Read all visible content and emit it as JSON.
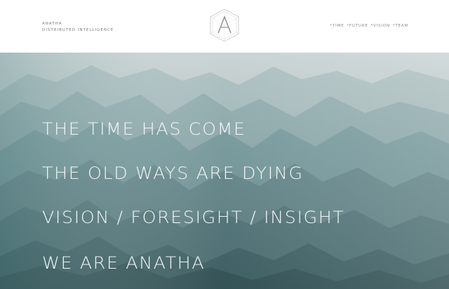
{
  "brand": {
    "name": "ANATHA",
    "tagline": "DISTRIBUTED INTELLIGENCE"
  },
  "logo": {
    "icon": "hexagon-a-logo-icon"
  },
  "nav": {
    "items": [
      {
        "label": "*TIME"
      },
      {
        "label": "*FUTURE"
      },
      {
        "label": "*VISION"
      },
      {
        "label": "*TEAM"
      }
    ]
  },
  "hero": {
    "background": "misty-mountains-image",
    "lines": [
      "THE TIME HAS COME",
      "THE OLD WAYS ARE DYING",
      "VISION / FORESIGHT  / INSIGHT",
      "WE ARE ANATHA"
    ]
  },
  "colors": {
    "headline": "#f4f6f6",
    "nav_text": "#8a8a8a",
    "sky_top": "#c9d3d3",
    "mountain_mid": "#6f9595",
    "mountain_dark": "#3d5f62"
  }
}
